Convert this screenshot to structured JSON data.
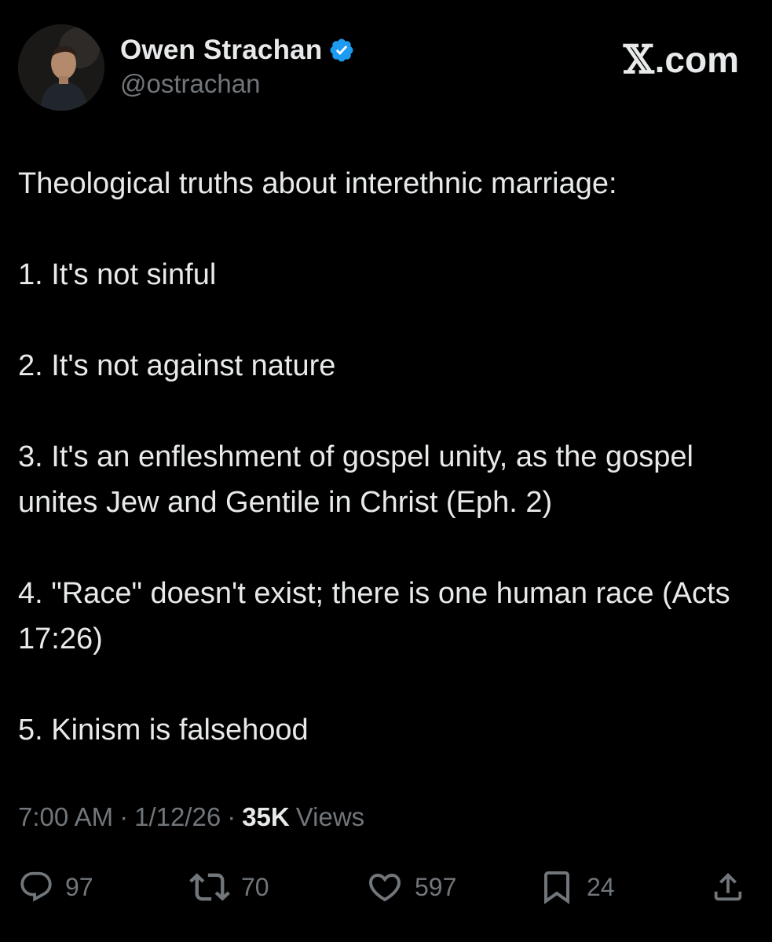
{
  "header": {
    "display_name": "Owen Strachan",
    "handle": "@ostrachan",
    "verified_icon": "verified-badge-icon",
    "site_label": "com",
    "site_x": "𝕏",
    "avatar": "profile-photo"
  },
  "tweet": {
    "intro": "Theological truths about interethnic marriage:",
    "points": [
      "1. It's not sinful",
      "2. It's not against nature",
      "3. It's an enfleshment of gospel unity, as the gospel unites Jew and Gentile in Christ (Eph. 2)",
      "4. \"Race\" doesn't exist; there is one human race (Acts 17:26)",
      "5. Kinism is falsehood"
    ]
  },
  "meta": {
    "time": "7:00 AM",
    "date": "1/12/26",
    "separator": "·",
    "views_count": "35K",
    "views_label": "Views"
  },
  "actions": {
    "replies": "97",
    "reposts": "70",
    "likes": "597",
    "bookmarks": "24"
  },
  "colors": {
    "background": "#000000",
    "primary_text": "#e7e9ea",
    "secondary_text": "#71767b",
    "verified_blue": "#1d9bf0"
  }
}
